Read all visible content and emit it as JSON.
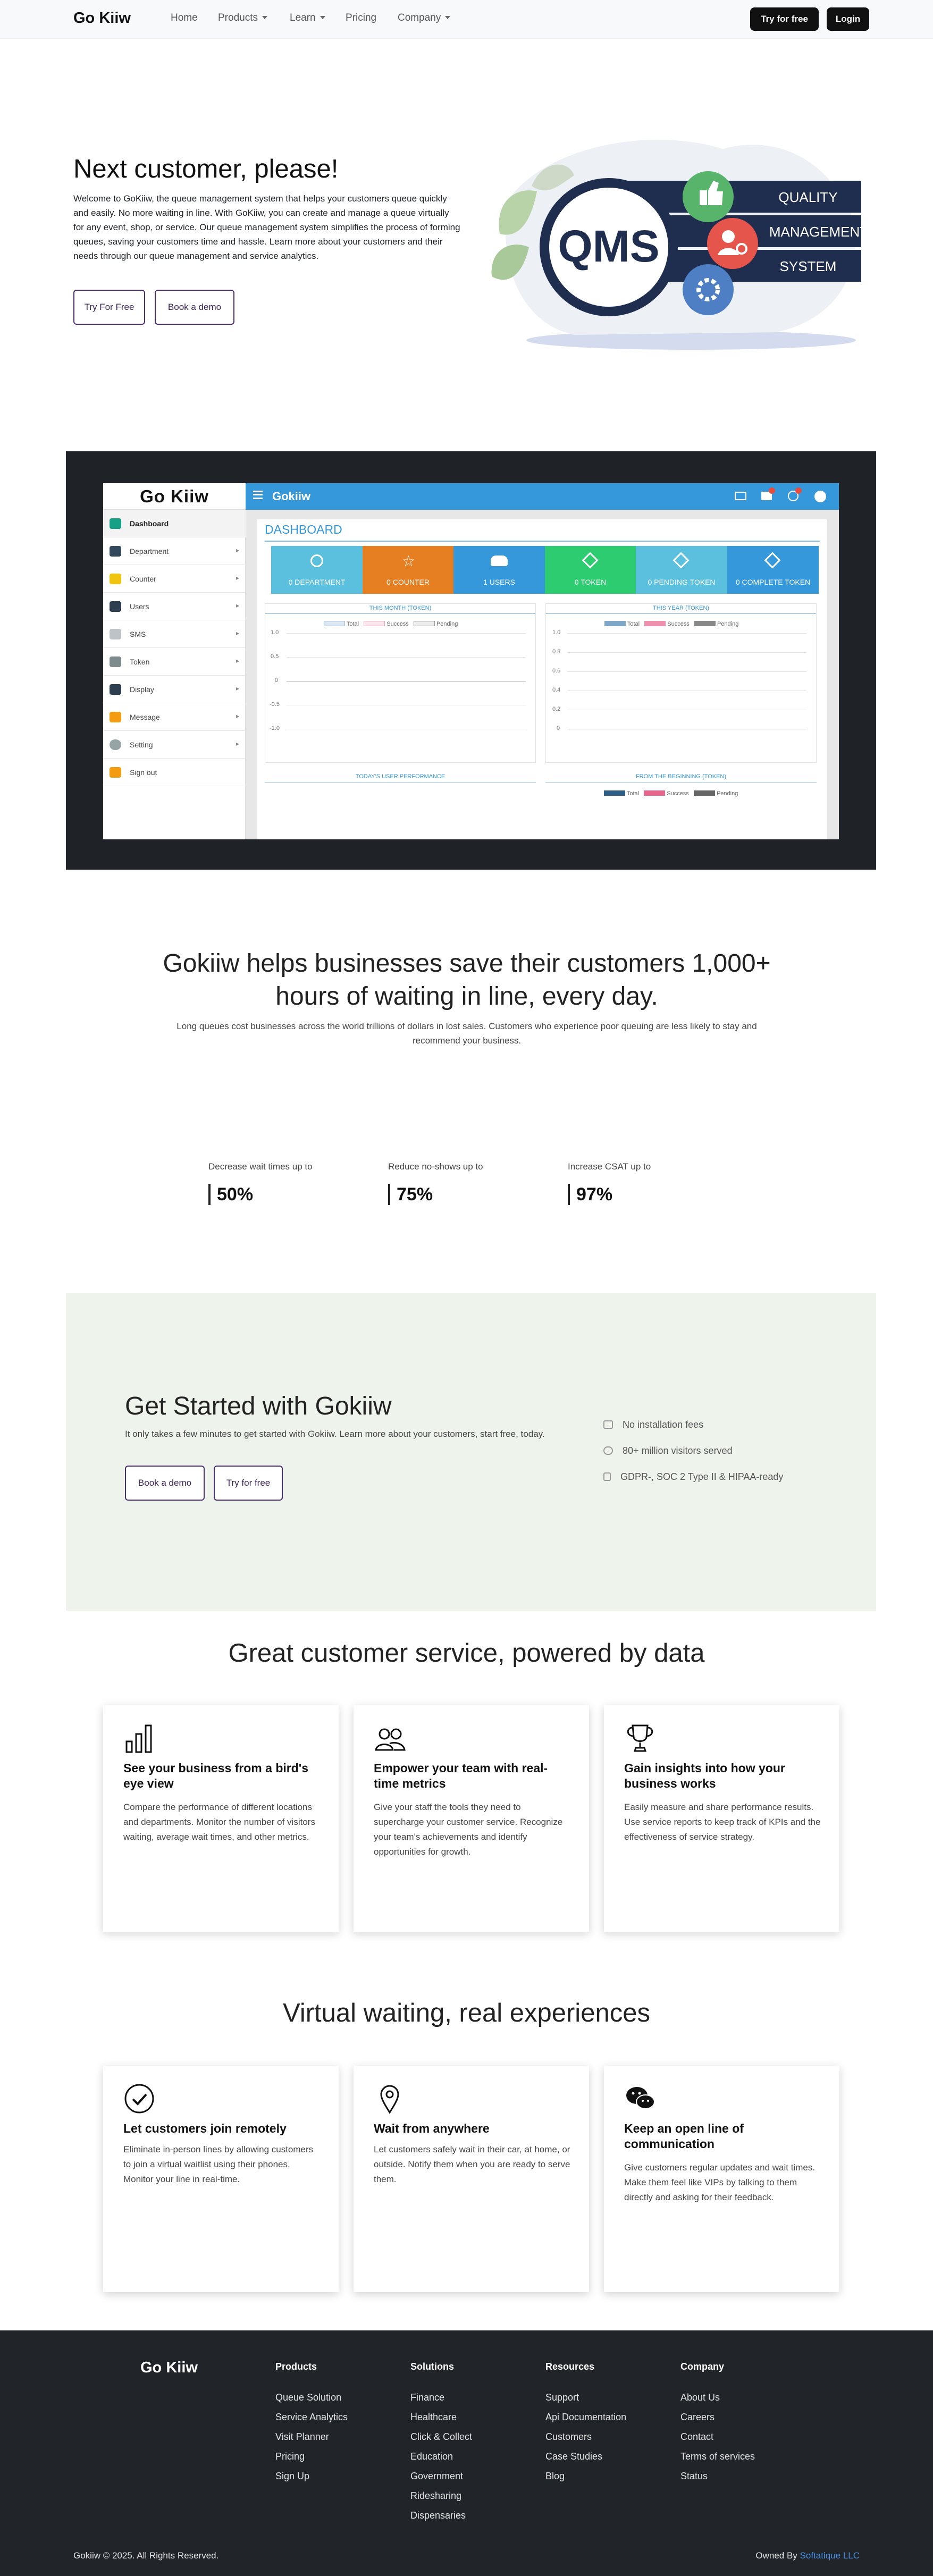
{
  "nav": {
    "brand": "Go Kiiw",
    "links": [
      "Home",
      "Products",
      "Learn",
      "Pricing",
      "Company"
    ],
    "try_label": "Try for free",
    "login_label": "Login"
  },
  "hero": {
    "title": "Next customer, please!",
    "text": "Welcome to GoKiiw, the queue management system that helps your customers queue quickly and easily. No more waiting in line. With GoKiiw, you can create and manage a queue virtually for any event, shop, or service. Our queue management system simplifies the process of forming queues, saving your customers time and hassle. Learn more about your customers and their needs through our queue management and service analytics.",
    "btn_try": "Try For Free",
    "btn_demo": "Book a demo",
    "illustration": {
      "center": "QMS",
      "labels": [
        "QUALITY",
        "MANAGEMENT",
        "SYSTEM"
      ]
    }
  },
  "dashboard": {
    "brand": "Go Kiiw",
    "app_name": "Gokiiw",
    "page_title": "DASHBOARD",
    "sidebar": [
      "Dashboard",
      "Department",
      "Counter",
      "Users",
      "SMS",
      "Token",
      "Display",
      "Message",
      "Setting",
      "Sign out"
    ],
    "tiles": [
      {
        "label": "0 DEPARTMENT",
        "color": "#5bc0de"
      },
      {
        "label": "0 COUNTER",
        "color": "#e67e22"
      },
      {
        "label": "1 USERS",
        "color": "#3498db"
      },
      {
        "label": "0 TOKEN",
        "color": "#2ecc71"
      },
      {
        "label": "0 PENDING TOKEN",
        "color": "#5bc0de"
      },
      {
        "label": "0 COMPLETE TOKEN",
        "color": "#3498db"
      }
    ],
    "panel_titles": [
      "THIS MONTH (TOKEN)",
      "THIS YEAR (TOKEN)",
      "TODAY'S USER PERFORMANCE",
      "FROM THE BEGINNING (TOKEN)"
    ],
    "legend": [
      "Total",
      "Success",
      "Pending"
    ],
    "left_ticks": [
      "1.0",
      "0.5",
      "0",
      "-0.5",
      "-1.0"
    ],
    "right_ticks": [
      "1.0",
      "0.8",
      "0.6",
      "0.4",
      "0.2",
      "0"
    ]
  },
  "savings": {
    "title": "Gokiiw helps businesses save their customers 1,000+ hours of waiting in line, every day.",
    "text": "Long queues cost businesses across the world trillions of dollars in lost sales. Customers who experience poor queuing are less likely to stay and recommend your business.",
    "stats": [
      {
        "label": "Decrease wait times up to",
        "value": "50%"
      },
      {
        "label": "Reduce no-shows up to",
        "value": "75%"
      },
      {
        "label": "Increase CSAT up to",
        "value": "97%"
      }
    ]
  },
  "get_started": {
    "title": "Get Started with Gokiiw",
    "text": "It only takes a few minutes to get started with Gokiiw. Learn more about your customers, start free, today.",
    "btn_demo": "Book a demo",
    "btn_try": "Try for free",
    "features": [
      "No installation fees",
      "80+ million visitors served",
      "GDPR-, SOC 2 Type II & HIPAA-ready"
    ],
    "bg_color": "#eef3ec"
  },
  "data_section": {
    "title": "Great customer service, powered by data",
    "cards": [
      {
        "icon": "bar-chart-icon",
        "title": "See your business from a bird's eye view",
        "text": "Compare the performance of different locations and departments. Monitor the number of visitors waiting, average wait times, and other metrics."
      },
      {
        "icon": "people-icon",
        "title": "Empower your team with real-time metrics",
        "text": "Give your staff the tools they need to supercharge your customer service. Recognize your team's achievements and identify opportunities for growth."
      },
      {
        "icon": "trophy-icon",
        "title": "Gain insights into how your business works",
        "text": "Easily measure and share performance results. Use service reports to keep track of KPIs and the effectiveness of service strategy."
      }
    ]
  },
  "virtual_section": {
    "title": "Virtual waiting, real experiences",
    "cards": [
      {
        "icon": "check-circle-icon",
        "title": "Let customers join remotely",
        "text": "Eliminate in-person lines by allowing customers to join a virtual waitlist using their phones. Monitor your line in real-time."
      },
      {
        "icon": "location-pin-icon",
        "title": "Wait from anywhere",
        "text": "Let customers safely wait in their car, at home, or outside. Notify them when you are ready to serve them."
      },
      {
        "icon": "chat-icon",
        "title": "Keep an open line of communication",
        "text": "Give customers regular updates and wait times. Make them feel like VIPs by talking to them directly and asking for their feedback."
      }
    ]
  },
  "footer": {
    "brand": "Go Kiiw",
    "columns": [
      {
        "title": "Products",
        "links": [
          "Queue Solution",
          "Service Analytics",
          "Visit Planner",
          "Pricing",
          "Sign Up"
        ]
      },
      {
        "title": "Solutions",
        "links": [
          "Finance",
          "Healthcare",
          "Click & Collect",
          "Education",
          "Government",
          "Ridesharing",
          "Dispensaries"
        ]
      },
      {
        "title": "Resources",
        "links": [
          "Support",
          "Api Documentation",
          "Customers",
          "Case Studies",
          "Blog"
        ]
      },
      {
        "title": "Company",
        "links": [
          "About Us",
          "Careers",
          "Contact",
          "Terms of services",
          "Status"
        ]
      }
    ],
    "copyright": "Gokiiw © 2025. All Rights Reserved.",
    "owned_prefix": "Owned By",
    "owner": "Softatique LLC",
    "owner_color": "#4a90e2"
  }
}
